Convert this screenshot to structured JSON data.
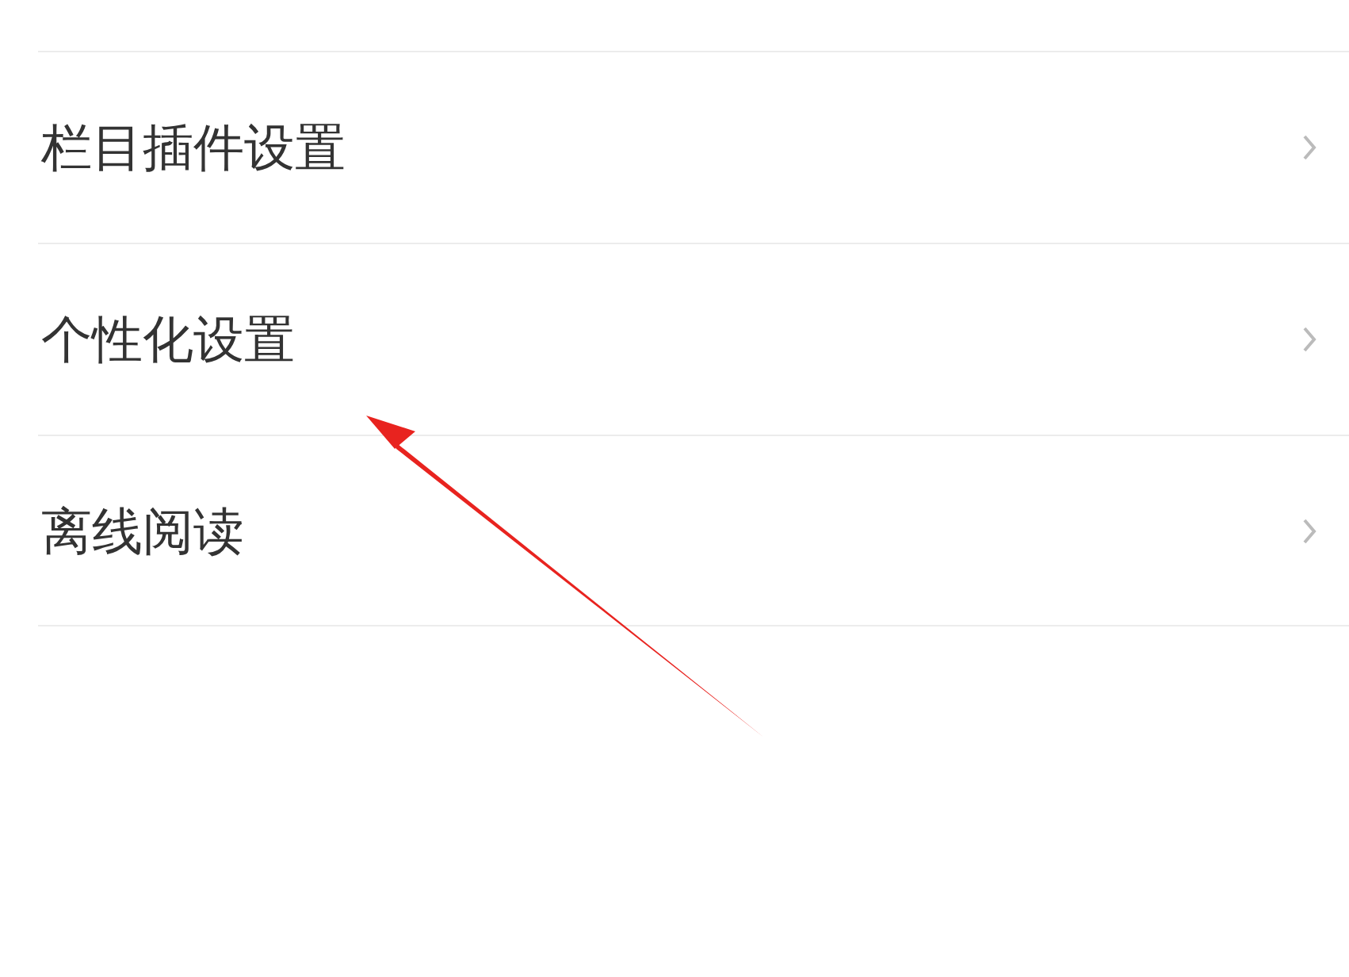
{
  "settings_list": [
    {
      "label": "栏目插件设置"
    },
    {
      "label": "个性化设置"
    },
    {
      "label": "离线阅读"
    }
  ]
}
